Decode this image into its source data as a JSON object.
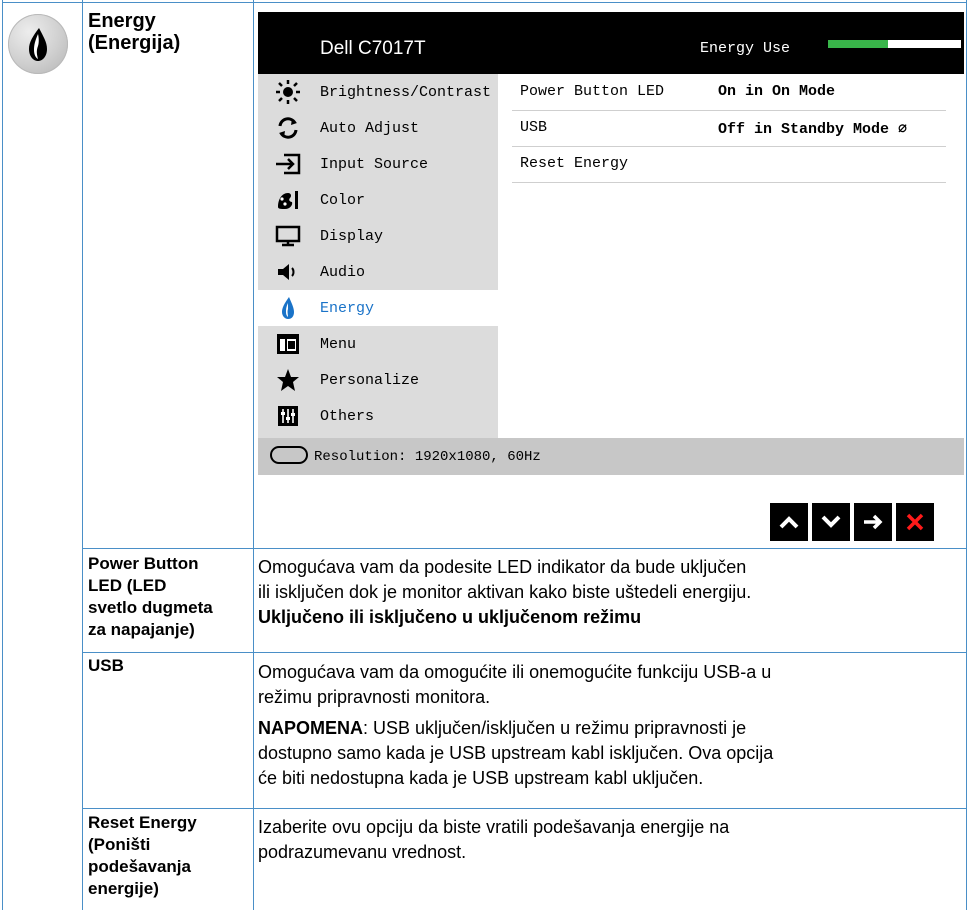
{
  "section": {
    "icon": "energy-drop-icon",
    "title_line1": "Energy",
    "title_line2": "(Energija)"
  },
  "osd": {
    "model": "Dell C7017T",
    "energy_use_label": "Energy Use",
    "energy_use_level": 0.45,
    "menu_items": [
      {
        "label": "Brightness/Contrast",
        "icon": "brightness-icon"
      },
      {
        "label": "Auto Adjust",
        "icon": "auto-adjust-icon"
      },
      {
        "label": "Input Source",
        "icon": "input-source-icon"
      },
      {
        "label": "Color",
        "icon": "color-icon"
      },
      {
        "label": "Display",
        "icon": "display-icon"
      },
      {
        "label": "Audio",
        "icon": "audio-icon"
      },
      {
        "label": "Energy",
        "icon": "energy-icon",
        "active": true
      },
      {
        "label": "Menu",
        "icon": "menu-icon"
      },
      {
        "label": "Personalize",
        "icon": "star-icon"
      },
      {
        "label": "Others",
        "icon": "others-icon"
      }
    ],
    "settings": [
      {
        "key": "Power Button LED",
        "value": "On in On Mode"
      },
      {
        "key": "USB",
        "value": "Off in Standby Mode ∅"
      },
      {
        "key": "Reset Energy",
        "value": ""
      }
    ],
    "resolution": "Resolution: 1920x1080, 60Hz",
    "nav_buttons": [
      "up-arrow-icon",
      "down-arrow-icon",
      "right-arrow-icon",
      "close-icon"
    ],
    "colors": {
      "energy_green": "#39b54a",
      "active_text": "#1a73c8",
      "close_red": "#ff1a1a"
    }
  },
  "rows": [
    {
      "label_lines": [
        "Power Button",
        "LED (LED",
        "svetlo dugmeta",
        "za napajanje)"
      ],
      "desc_lines": [
        "Omogućava vam da podesite LED indikator da bude uključen",
        "ili isključen dok je monitor aktivan kako biste uštedeli energiju."
      ],
      "bold_line": "Uključeno ili isključeno u uključenom režimu"
    },
    {
      "label_lines": [
        "USB"
      ],
      "desc_lines": [
        "Omogućava vam da omogućite ili onemogućite funkciju USB-a u",
        "režimu pripravnosti monitora."
      ],
      "note_bold": "NAPOMENA",
      "note_lines": [
        ": USB uključen/isključen u režimu pripravnosti je",
        "dostupno samo kada je USB upstream kabl isključen. Ova opcija",
        "će biti nedostupna kada je USB upstream kabl uključen."
      ]
    },
    {
      "label_lines": [
        "Reset Energy",
        "(Poništi",
        "podešavanja",
        "energije)"
      ],
      "desc_lines": [
        "Izaberite ovu opciju da biste vratili podešavanja energije na",
        "podrazumevanu vrednost."
      ]
    }
  ]
}
